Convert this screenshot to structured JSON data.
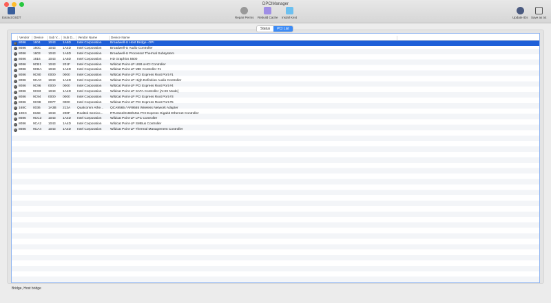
{
  "window": {
    "title": "DPCIManager"
  },
  "toolbar": {
    "extract_dsdt": "Extract DSDT",
    "repair_perms": "Repair Perms",
    "rebuild_cache": "Rebuild Cache",
    "install_kext": "Install Kext",
    "update_ids": "Update IDs",
    "save_as_txt": "Save as txt"
  },
  "tabs": {
    "status": "Status",
    "pci_list": "PCI List"
  },
  "columns": [
    "Vendor",
    "Device",
    "Sub V...",
    "Sub D...",
    "Vendor Name",
    "Device Name"
  ],
  "rows": [
    [
      "8086",
      "1604",
      "1043",
      "1A5D",
      "Intel Corporation",
      "Broadwell-U Host Bridge -OPI"
    ],
    [
      "8086",
      "160C",
      "1043",
      "1A4D",
      "Intel Corporation",
      "Broadwell-U Audio Controller"
    ],
    [
      "8086",
      "1603",
      "1043",
      "1A5D",
      "Intel Corporation",
      "Broadwell-U Processor Thermal Subsystem"
    ],
    [
      "8086",
      "1616",
      "1043",
      "1A5D",
      "Intel Corporation",
      "HD Graphics 5500"
    ],
    [
      "8086",
      "9CB1",
      "1043",
      "201F",
      "Intel Corporation",
      "Wildcat Point-LP USB xHCI Controller"
    ],
    [
      "8086",
      "9CBA",
      "1043",
      "1A4D",
      "Intel Corporation",
      "Wildcat Point-LP MEI Controller #1"
    ],
    [
      "8086",
      "9C90",
      "0000",
      "0000",
      "Intel Corporation",
      "Wildcat Point-LP PCI Express Root Port #1"
    ],
    [
      "8086",
      "9CA0",
      "1043",
      "1A4D",
      "Intel Corporation",
      "Wildcat Point-LP High Definition Audio Controller"
    ],
    [
      "8086",
      "9C96",
      "0000",
      "0000",
      "Intel Corporation",
      "Wildcat Point-LP PCI Express Root Port #4"
    ],
    [
      "8086",
      "9C83",
      "1043",
      "1A4D",
      "Intel Corporation",
      "Wildcat Point-LP SATA Controller [AHCI Mode]"
    ],
    [
      "8086",
      "9C94",
      "0000",
      "0000",
      "Intel Corporation",
      "Wildcat Point-LP PCI Express Root Port #3"
    ],
    [
      "8086",
      "9C98",
      "007F",
      "0000",
      "Intel Corporation",
      "Wildcat Point-LP PCI Express Root Port #5"
    ],
    [
      "168C",
      "0036",
      "1A3B",
      "213A",
      "Qualcomm Athe...",
      "QCA9565 / AR9565 Wireless Network Adapter"
    ],
    [
      "10EC",
      "8168",
      "1043",
      "200F",
      "Realtek Semico...",
      "RTL8111/8168/8411 PCI Express Gigabit Ethernet Controller"
    ],
    [
      "8086",
      "9CC3",
      "1043",
      "1A4D",
      "Intel Corporation",
      "Wildcat Point-LP LPC Controller"
    ],
    [
      "8086",
      "9CA2",
      "1043",
      "1A4D",
      "Intel Corporation",
      "Wildcat Point-LP SMBus Controller"
    ],
    [
      "8086",
      "9CA4",
      "1043",
      "1A4D",
      "Intel Corporation",
      "Wildcat Point-LP Thermal Management Controller"
    ]
  ],
  "selected_row": 0,
  "status_text": "Bridge, Host bridge"
}
